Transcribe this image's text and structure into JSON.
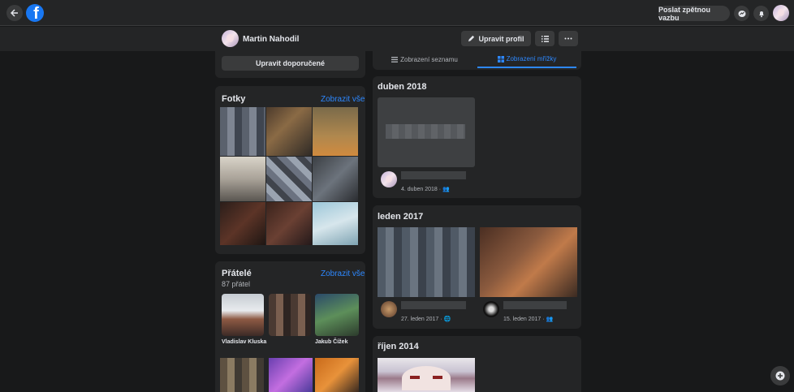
{
  "topbar": {
    "feedback_button": "Poslat zpětnou vazbu",
    "icons": [
      "back-arrow-icon",
      "facebook-logo-icon",
      "messenger-icon",
      "bell-icon"
    ]
  },
  "profile": {
    "name": "Martin Nahodil",
    "edit_button": "Upravit profil",
    "list_icon": "list-icon",
    "more_icon": "more-icon"
  },
  "left": {
    "edit_recommended": "Upravit doporučené",
    "photos_title": "Fotky",
    "photos_link": "Zobrazit vše",
    "friends_title": "Přátelé",
    "friends_count": "87 přátel",
    "friends_link": "Zobrazit vše",
    "friends": [
      {
        "name": "Vladislav Kluska"
      },
      {
        "name": ""
      },
      {
        "name": "Jakub Čížek"
      }
    ]
  },
  "view_tabs": {
    "list": "Zobrazení seznamu",
    "grid": "Zobrazení mřížky",
    "active": "grid"
  },
  "timeline": [
    {
      "month": "duben 2018",
      "posts": [
        {
          "date": "4. duben 2018 · "
        }
      ]
    },
    {
      "month": "leden 2017",
      "posts": [
        {
          "date": "27. leden 2017 · "
        },
        {
          "date": "15. leden 2017 · "
        }
      ]
    },
    {
      "month": "říjen 2014",
      "posts": []
    }
  ],
  "colors": {
    "accent": "#2d88ff",
    "card": "#242526",
    "bg": "#18191a"
  }
}
